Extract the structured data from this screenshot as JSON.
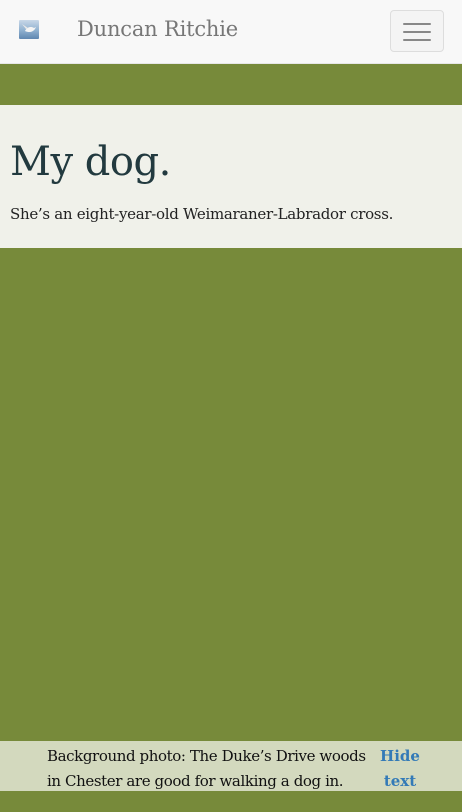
{
  "navbar": {
    "logo_icon": "seagull-photo-icon",
    "brand_name": "Duncan Ritchie",
    "menu_icon": "hamburger-icon"
  },
  "intro": {
    "title": "My dog.",
    "subtitle": "She’s an eight-year-old Weimaraner-Labrador cross."
  },
  "caption": {
    "text": "Background photo: The Duke’s Drive woods in Chester are good for walking a dog in.",
    "toggle_label": "Hide text"
  },
  "colors": {
    "background": "#778a3a",
    "navbar": "#f8f8f8",
    "intro_panel": "#f0f1ea",
    "caption_bar": "#d3d9be",
    "link": "#337ab7",
    "title": "#223a3f"
  }
}
